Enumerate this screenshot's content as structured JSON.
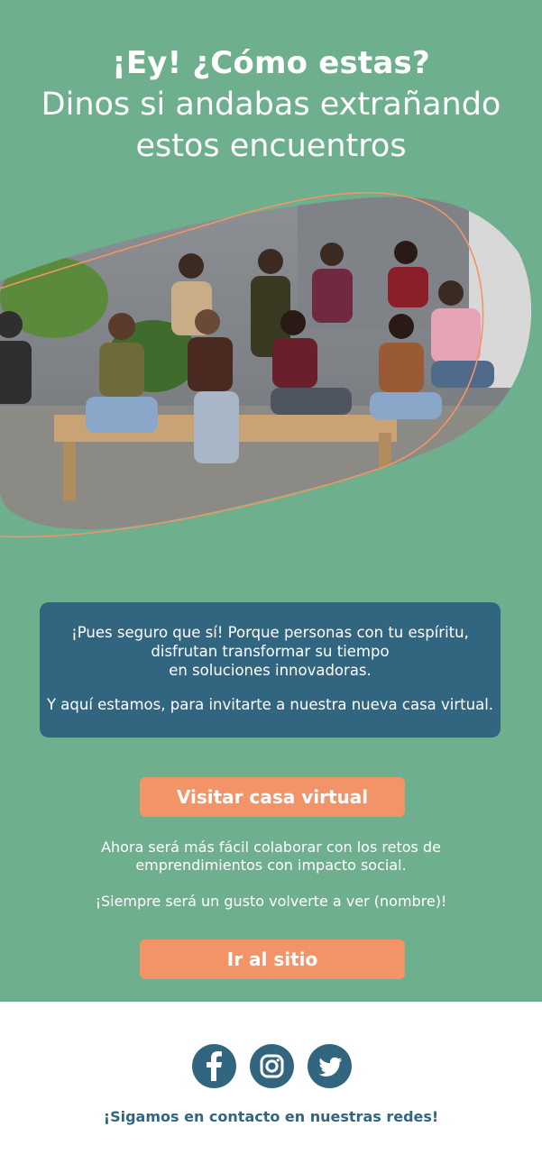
{
  "header": {
    "line1": "¡Ey! ¿Cómo estas?",
    "line2": "Dinos si andabas extrañando",
    "line3": "estos encuentros"
  },
  "photo": {
    "description_icon": "group-photo-image"
  },
  "info": {
    "p1_line1": "¡Pues seguro que sí! Porque personas con tu espíritu,",
    "p1_line2": "disfrutan transformar su tiempo",
    "p1_line3": "en soluciones innovadoras.",
    "p2": "Y aquí estamos, para invitarte a nuestra nueva casa virtual."
  },
  "cta1": {
    "label": "Visitar casa virtual"
  },
  "note1": {
    "line1": "Ahora será más fácil colaborar con los retos de",
    "line2": "emprendimientos con impacto social."
  },
  "note2": {
    "line1": "¡Siempre será un gusto volverte a ver (nombre)!"
  },
  "cta2": {
    "label": "Ir al sitio"
  },
  "footer": {
    "social_icons": [
      "facebook-icon",
      "instagram-icon",
      "twitter-icon"
    ],
    "text": "¡Sigamos en contacto en nuestras redes!"
  },
  "colors": {
    "hero_green": "#6eaf8e",
    "info_blue": "#326680",
    "button_orange": "#f29468"
  }
}
